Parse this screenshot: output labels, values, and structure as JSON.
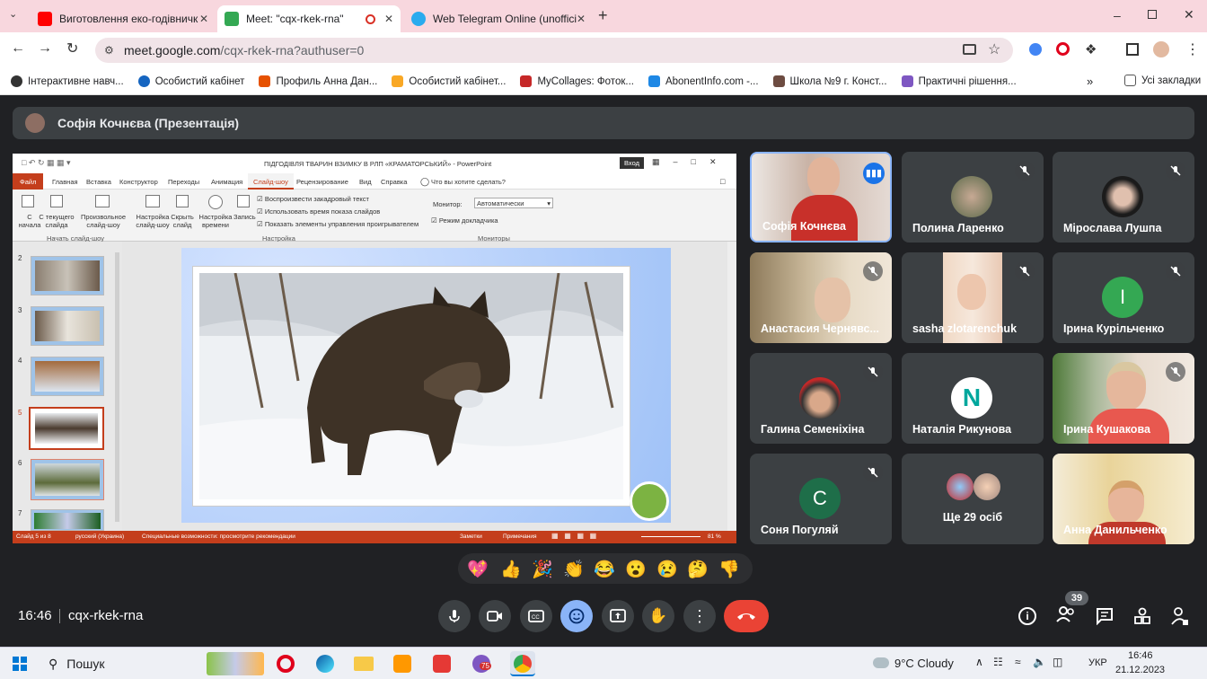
{
  "browser": {
    "tabs": [
      {
        "title": "Виготовлення еко-годівничк",
        "color": "#ff0000"
      },
      {
        "title": "Meet: \"cqx-rkek-rna\"",
        "color": "#34a853"
      },
      {
        "title": "Web Telegram Online (unoffici",
        "color": "#2aabee"
      }
    ],
    "url_main": "meet.google.com",
    "url_rest": "/cqx-rkek-rna?authuser=0",
    "bookmarks": [
      {
        "label": "Інтерактивне навч...",
        "color": "#333"
      },
      {
        "label": "Особистий кабінет",
        "color": "#1565c0"
      },
      {
        "label": "Профиль Анна Дан...",
        "color": "#e65100"
      },
      {
        "label": "Особистий кабінет...",
        "color": "#f9a825"
      },
      {
        "label": "MyCollages: Фоток...",
        "color": "#c62828"
      },
      {
        "label": "AbonentInfo.com -...",
        "color": "#1e88e5"
      },
      {
        "label": "Школа №9 г. Конст...",
        "color": "#6d4c41"
      },
      {
        "label": "Практичні рішення...",
        "color": "#7e57c2"
      }
    ],
    "all_bookmarks": "Усі закладки"
  },
  "presenter": {
    "label": "Софія Кочнєва (Презентація)"
  },
  "ppt": {
    "title": "ПІДГОДІВЛЯ ТВАРИН ВЗИМКУ В РЛП «КРАМАТОРСЬКИЙ» - PowerPoint",
    "signin": "Вход",
    "tabs": [
      "Файл",
      "Главная",
      "Вставка",
      "Конструктор",
      "Переходы",
      "Анимация",
      "Слайд-шоу",
      "Рецензирование",
      "Вид",
      "Справка"
    ],
    "tell": "Что вы хотите сделать?",
    "ribbon": {
      "from_start": "С начала",
      "from_current": "С текущего слайда",
      "custom": "Произвольное слайд-шоу",
      "group_start": "Начать слайд-шоу",
      "setup": "Настройка слайд-шоу",
      "hide": "Скрыть слайд",
      "rehearse": "Настройка времени",
      "record": "Запись",
      "chk1": "Воспроизвести закадровый текст",
      "chk2": "Использовать время показа слайдов",
      "chk3": "Показать элементы управления проигрывателем",
      "group_setup": "Настройка",
      "monitor_label": "Монитор:",
      "monitor_value": "Автоматически",
      "presenter_view": "Режим докладчика",
      "group_monitors": "Мониторы"
    },
    "slide_numbers": [
      "2",
      "3",
      "4",
      "5",
      "6",
      "7"
    ],
    "status": {
      "slide": "Слайд 5 из 8",
      "lang": "русский (Украина)",
      "access": "Специальные возможности: просмотрите рекомендации",
      "notes": "Заметки",
      "comments": "Примечания",
      "zoom": "81 %"
    }
  },
  "participants": [
    {
      "name": "Софія Кочнєва",
      "type": "video",
      "speaking": true
    },
    {
      "name": "Полина Ларенко",
      "type": "photo"
    },
    {
      "name": "Мірослава Лушпа",
      "type": "photo"
    },
    {
      "name": "Анастасия Чернявс...",
      "type": "video"
    },
    {
      "name": "sasha zlotarenchuk",
      "type": "video"
    },
    {
      "name": "Ірина Курільченко",
      "type": "initial",
      "initial": "I",
      "color": "#34a853"
    },
    {
      "name": "Галина Семеніхіна",
      "type": "photo"
    },
    {
      "name": "Наталія Рикунова",
      "type": "logo",
      "initial": "N"
    },
    {
      "name": "Ірина Кушакова",
      "type": "video"
    },
    {
      "name": "Соня Погуляй",
      "type": "initial",
      "initial": "C",
      "color": "#1e6e49"
    },
    {
      "name": "Ще 29 осіб",
      "type": "more"
    },
    {
      "name": "Анна Данильченко",
      "type": "video"
    }
  ],
  "reactions": [
    "💖",
    "👍",
    "🎉",
    "👏",
    "😂",
    "😮",
    "😢",
    "🤔",
    "👎"
  ],
  "meeting": {
    "time": "16:46",
    "code": "cqx-rkek-rna",
    "people_count": "39"
  },
  "taskbar": {
    "search": "Пошук",
    "weather": "9°C  Cloudy",
    "lang": "УКР",
    "time": "16:46",
    "date": "21.12.2023",
    "badge": "75"
  }
}
